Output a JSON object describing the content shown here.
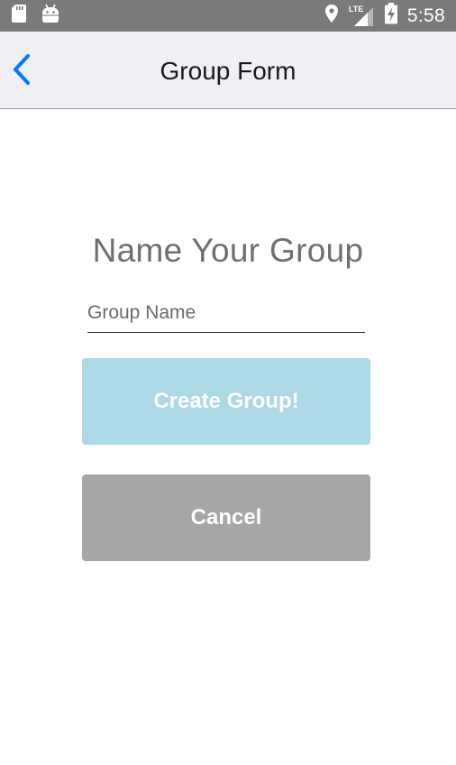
{
  "status_bar": {
    "time": "5:58",
    "network_label": "LTE",
    "icons": [
      "sd-card-icon",
      "android-icon",
      "location-icon",
      "signal-icon",
      "battery-charging-icon"
    ]
  },
  "app_bar": {
    "title": "Group Form",
    "back_icon": "chevron-left-icon"
  },
  "form": {
    "heading": "Name Your Group",
    "group_name": {
      "placeholder": "Group Name",
      "value": ""
    },
    "create_label": "Create Group!",
    "cancel_label": "Cancel"
  },
  "colors": {
    "status_bar": "#7a7a7a",
    "app_bar": "#efeff4",
    "accent": "#007aff",
    "create_button": "#add8e6",
    "cancel_button": "#a6a6a6",
    "heading_text": "#6f6f6f"
  }
}
